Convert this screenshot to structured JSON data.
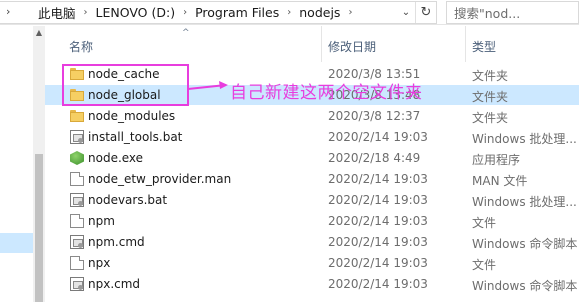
{
  "address_bar": {
    "breadcrumbs": [
      "此电脑",
      "LENOVO (D:)",
      "Program Files",
      "nodejs"
    ]
  },
  "search": {
    "placeholder": "搜索\"nod..."
  },
  "columns": {
    "name": "名称",
    "date": "修改日期",
    "type": "类型"
  },
  "files": [
    {
      "name": "node_cache",
      "date": "2020/3/8 13:51",
      "type": "文件夹",
      "icon": "folder-icon"
    },
    {
      "name": "node_global",
      "date": "2020/3/8 13:48",
      "type": "文件夹",
      "icon": "folder-icon",
      "selected": true
    },
    {
      "name": "node_modules",
      "date": "2020/3/8 12:37",
      "type": "文件夹",
      "icon": "folder-icon"
    },
    {
      "name": "install_tools.bat",
      "date": "2020/2/14 19:03",
      "type": "Windows 批处理...",
      "icon": "batch-file-icon"
    },
    {
      "name": "node.exe",
      "date": "2020/2/18 4:49",
      "type": "应用程序",
      "icon": "nodejs-exe-icon"
    },
    {
      "name": "node_etw_provider.man",
      "date": "2020/2/14 19:03",
      "type": "MAN 文件",
      "icon": "file-icon"
    },
    {
      "name": "nodevars.bat",
      "date": "2020/2/14 19:03",
      "type": "Windows 批处理...",
      "icon": "batch-file-icon"
    },
    {
      "name": "npm",
      "date": "2020/2/14 19:03",
      "type": "文件",
      "icon": "file-icon"
    },
    {
      "name": "npm.cmd",
      "date": "2020/2/14 19:03",
      "type": "Windows 命令脚本",
      "icon": "batch-file-icon"
    },
    {
      "name": "npx",
      "date": "2020/2/14 19:03",
      "type": "文件",
      "icon": "file-icon"
    },
    {
      "name": "npx.cmd",
      "date": "2020/2/14 19:03",
      "type": "Windows 命令脚本",
      "icon": "batch-file-icon"
    }
  ],
  "annotation": {
    "text": "自己新建这两个空文件夹",
    "color": "#e83dde"
  },
  "colors": {
    "selection": "#cce8ff",
    "header_text": "#4c607a",
    "secondary_text": "#6d6d6d"
  }
}
